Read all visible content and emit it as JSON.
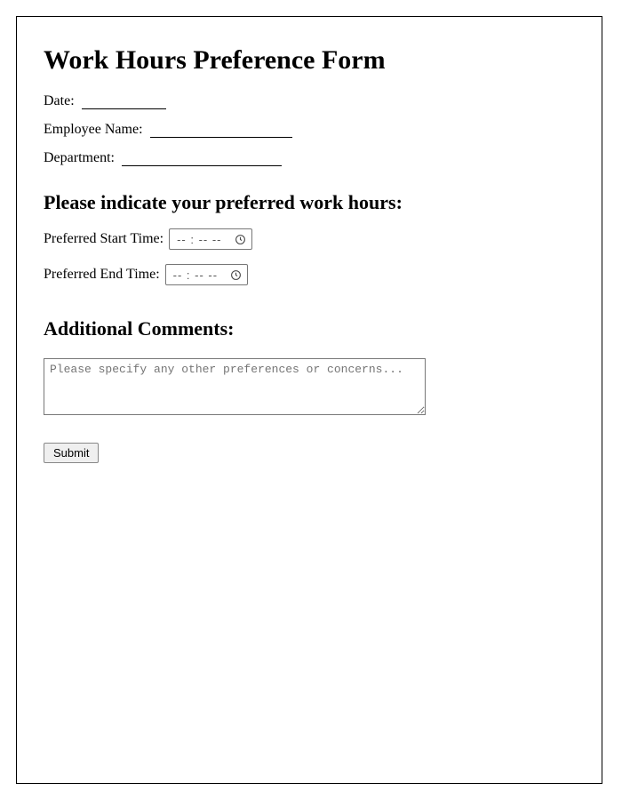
{
  "title": "Work Hours Preference Form",
  "fields": {
    "date_label": "Date:",
    "name_label": "Employee Name:",
    "dept_label": "Department:"
  },
  "section1_heading": "Please indicate your preferred work hours:",
  "start_label": "Preferred Start Time:",
  "end_label": "Preferred End Time:",
  "time_placeholder": "-- : --   --",
  "section2_heading": "Additional Comments:",
  "comments_placeholder": "Please specify any other preferences or concerns...",
  "submit_label": "Submit"
}
